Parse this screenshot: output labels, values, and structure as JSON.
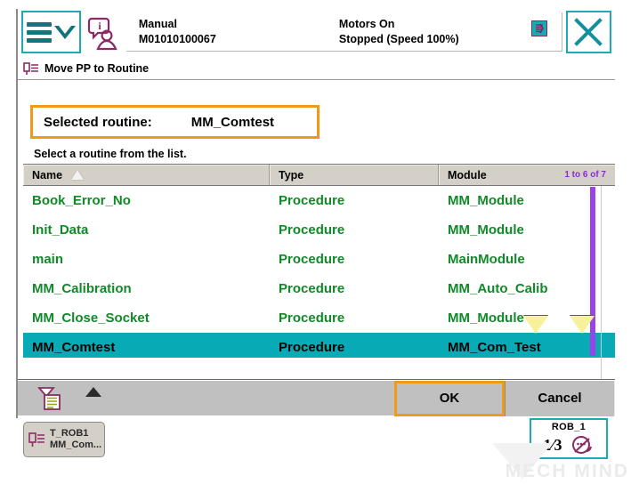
{
  "statusbar": {
    "menu_icon": "hamburger-menu-icon",
    "chevron_icon": "chevron-down-icon",
    "operator_icon": "operator-info-icon",
    "mode": "Manual",
    "controller_id": "M01010100067",
    "motors": "Motors On",
    "exec_state": "Stopped (Speed 100%)",
    "production_icon": "production-window-icon",
    "close_icon": "close-x-icon"
  },
  "apptitle": {
    "icon": "move-pp-icon",
    "label": "Move PP to Routine"
  },
  "selected": {
    "label": "Selected routine:",
    "value": "MM_Comtest",
    "hint": "Select a routine from the list.",
    "accent": "#ED9B18"
  },
  "table": {
    "columns": [
      "Name",
      "Type",
      "Module"
    ],
    "sort_icon": "sort-ascending-icon",
    "pager": "1 to 6 of 7",
    "pager_color": "#8B2BD6",
    "selected_row_index": 5,
    "selected_color": "#08ABB5",
    "row_color": "#108A28",
    "rows": [
      {
        "name": "Book_Error_No",
        "type": "Procedure",
        "module": "MM_Module"
      },
      {
        "name": "Init_Data",
        "type": "Procedure",
        "module": "MM_Module"
      },
      {
        "name": "main",
        "type": "Procedure",
        "module": "MainModule"
      },
      {
        "name": "MM_Calibration",
        "type": "Procedure",
        "module": "MM_Auto_Calib"
      },
      {
        "name": "MM_Close_Socket",
        "type": "Procedure",
        "module": "MM_Module"
      },
      {
        "name": "MM_Comtest",
        "type": "Procedure",
        "module": "MM_Com_Test"
      }
    ]
  },
  "actionbar": {
    "filter_icon": "filter-document-icon",
    "expand_icon": "caret-up-icon",
    "ok_label": "OK",
    "cancel_label": "Cancel"
  },
  "taskbar": {
    "task_icon": "program-editor-icon",
    "task_line1": "T_ROB1",
    "task_line2": "MM_Com...",
    "quickset_title": "ROB_1",
    "quickset_fraction": "1⁄3",
    "quickset_icon": "quickset-jog-icon"
  },
  "watermark": {
    "text": "MECH MIND"
  }
}
